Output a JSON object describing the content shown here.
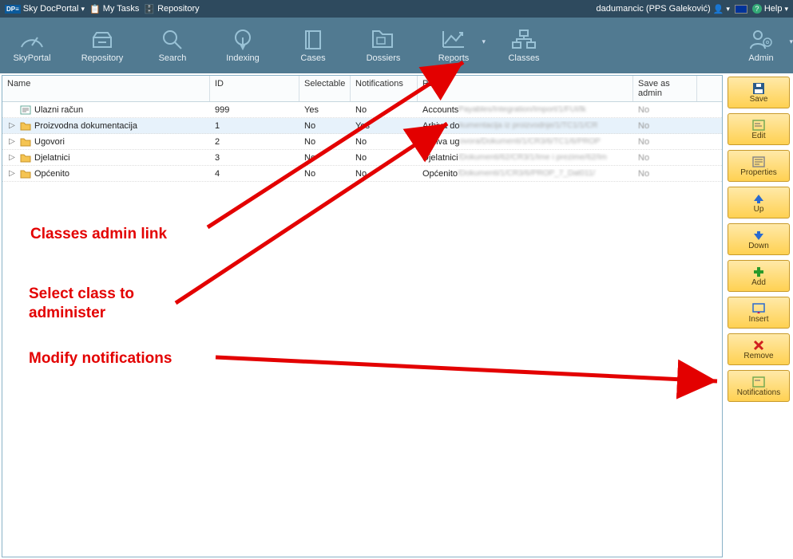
{
  "topbar": {
    "appName": "Sky DocPortal",
    "myTasks": "My Tasks",
    "repository": "Repository",
    "user": "dadumancic (PPS Galeković)",
    "help": "Help"
  },
  "ribbon": {
    "skyportal": "SkyPortal",
    "repository": "Repository",
    "search": "Search",
    "indexing": "Indexing",
    "cases": "Cases",
    "dossiers": "Dossiers",
    "reports": "Reports",
    "classes": "Classes",
    "admin": "Admin"
  },
  "headers": {
    "name": "Name",
    "id": "ID",
    "selectable": "Selectable",
    "notifications": "Notifications",
    "path": "Path",
    "saveAsAdmin": "Save as admin"
  },
  "rows": [
    {
      "name": "Ulazni račun",
      "id": "999",
      "sel": "Yes",
      "not": "No",
      "path": "Accounts",
      "pathRest": "Payables/Integration/Import/1/FUI/lk",
      "save": "No",
      "type": "doc",
      "expand": ""
    },
    {
      "name": "Proizvodna dokumentacija",
      "id": "1",
      "sel": "No",
      "not": "Yes",
      "path": "Arhiva do",
      "pathRest": "kumentacija iz proizvodnje/1/TC1/1/CR",
      "save": "No",
      "type": "folder",
      "expand": "▷",
      "selected": true
    },
    {
      "name": "Ugovori",
      "id": "2",
      "sel": "No",
      "not": "No",
      "path": "Arhiva ug",
      "pathRest": "ovora/Dokumenti/1/CR3/6/TC1/6/PROP",
      "save": "No",
      "type": "folder",
      "expand": "▷"
    },
    {
      "name": "Djelatnici",
      "id": "3",
      "sel": "No",
      "not": "No",
      "path": "Djelatnici",
      "pathRest": "/Dokumenti/62/CR3/1/Ime i prezime/62/Im",
      "save": "No",
      "type": "folder",
      "expand": "▷"
    },
    {
      "name": "Općenito",
      "id": "4",
      "sel": "No",
      "not": "No",
      "path": "Općenito",
      "pathRest": "/Dokumenti/1/CR3/6/PROP_7_Dat011/",
      "save": "No",
      "type": "folder",
      "expand": "▷"
    }
  ],
  "side": {
    "save": "Save",
    "edit": "Edit",
    "properties": "Properties",
    "up": "Up",
    "down": "Down",
    "add": "Add",
    "insert": "Insert",
    "remove": "Remove",
    "notifications": "Notifications"
  },
  "annot": {
    "a1": "Classes admin link",
    "a2": "Select class to administer",
    "a3": "Modify notifications"
  }
}
